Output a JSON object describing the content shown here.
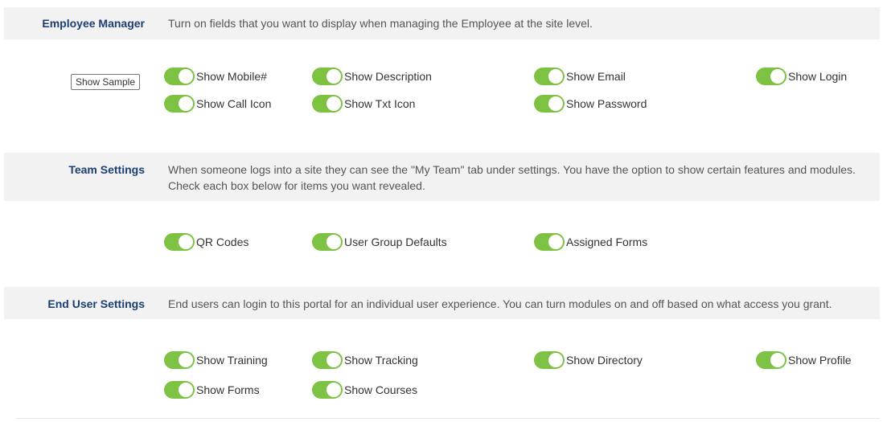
{
  "colors": {
    "toggle_on": "#7dc242",
    "section_title": "#1c3f73",
    "band_bg": "#f2f2f2"
  },
  "sections": [
    {
      "title": "Employee Manager",
      "description": "Turn on fields that you want to display when managing the Employee at the site level.",
      "sample_button": "Show Sample",
      "toggles": [
        {
          "label": "Show Mobile#",
          "on": true
        },
        {
          "label": "Show Description",
          "on": true
        },
        {
          "label": "Show Email",
          "on": true
        },
        {
          "label": "Show Login",
          "on": true
        },
        {
          "label": "Show Call Icon",
          "on": true
        },
        {
          "label": "Show Txt Icon",
          "on": true
        },
        {
          "label": "Show Password",
          "on": true
        }
      ]
    },
    {
      "title": "Team Settings",
      "description": "When someone logs into a site they can see the \"My Team\" tab under settings. You have the option to show certain features and modules. Check each box below for items you want revealed.",
      "toggles": [
        {
          "label": "QR Codes",
          "on": true
        },
        {
          "label": "User Group Defaults",
          "on": true
        },
        {
          "label": "Assigned Forms",
          "on": true
        }
      ]
    },
    {
      "title": "End User Settings",
      "description": "End users can login to this portal for an individual user experience. You can turn modules on and off based on what access you grant.",
      "toggles": [
        {
          "label": "Show Training",
          "on": true
        },
        {
          "label": "Show Tracking",
          "on": true
        },
        {
          "label": "Show Directory",
          "on": true
        },
        {
          "label": "Show Profile",
          "on": true
        },
        {
          "label": "Show Forms",
          "on": true
        },
        {
          "label": "Show Courses",
          "on": true
        }
      ]
    }
  ]
}
